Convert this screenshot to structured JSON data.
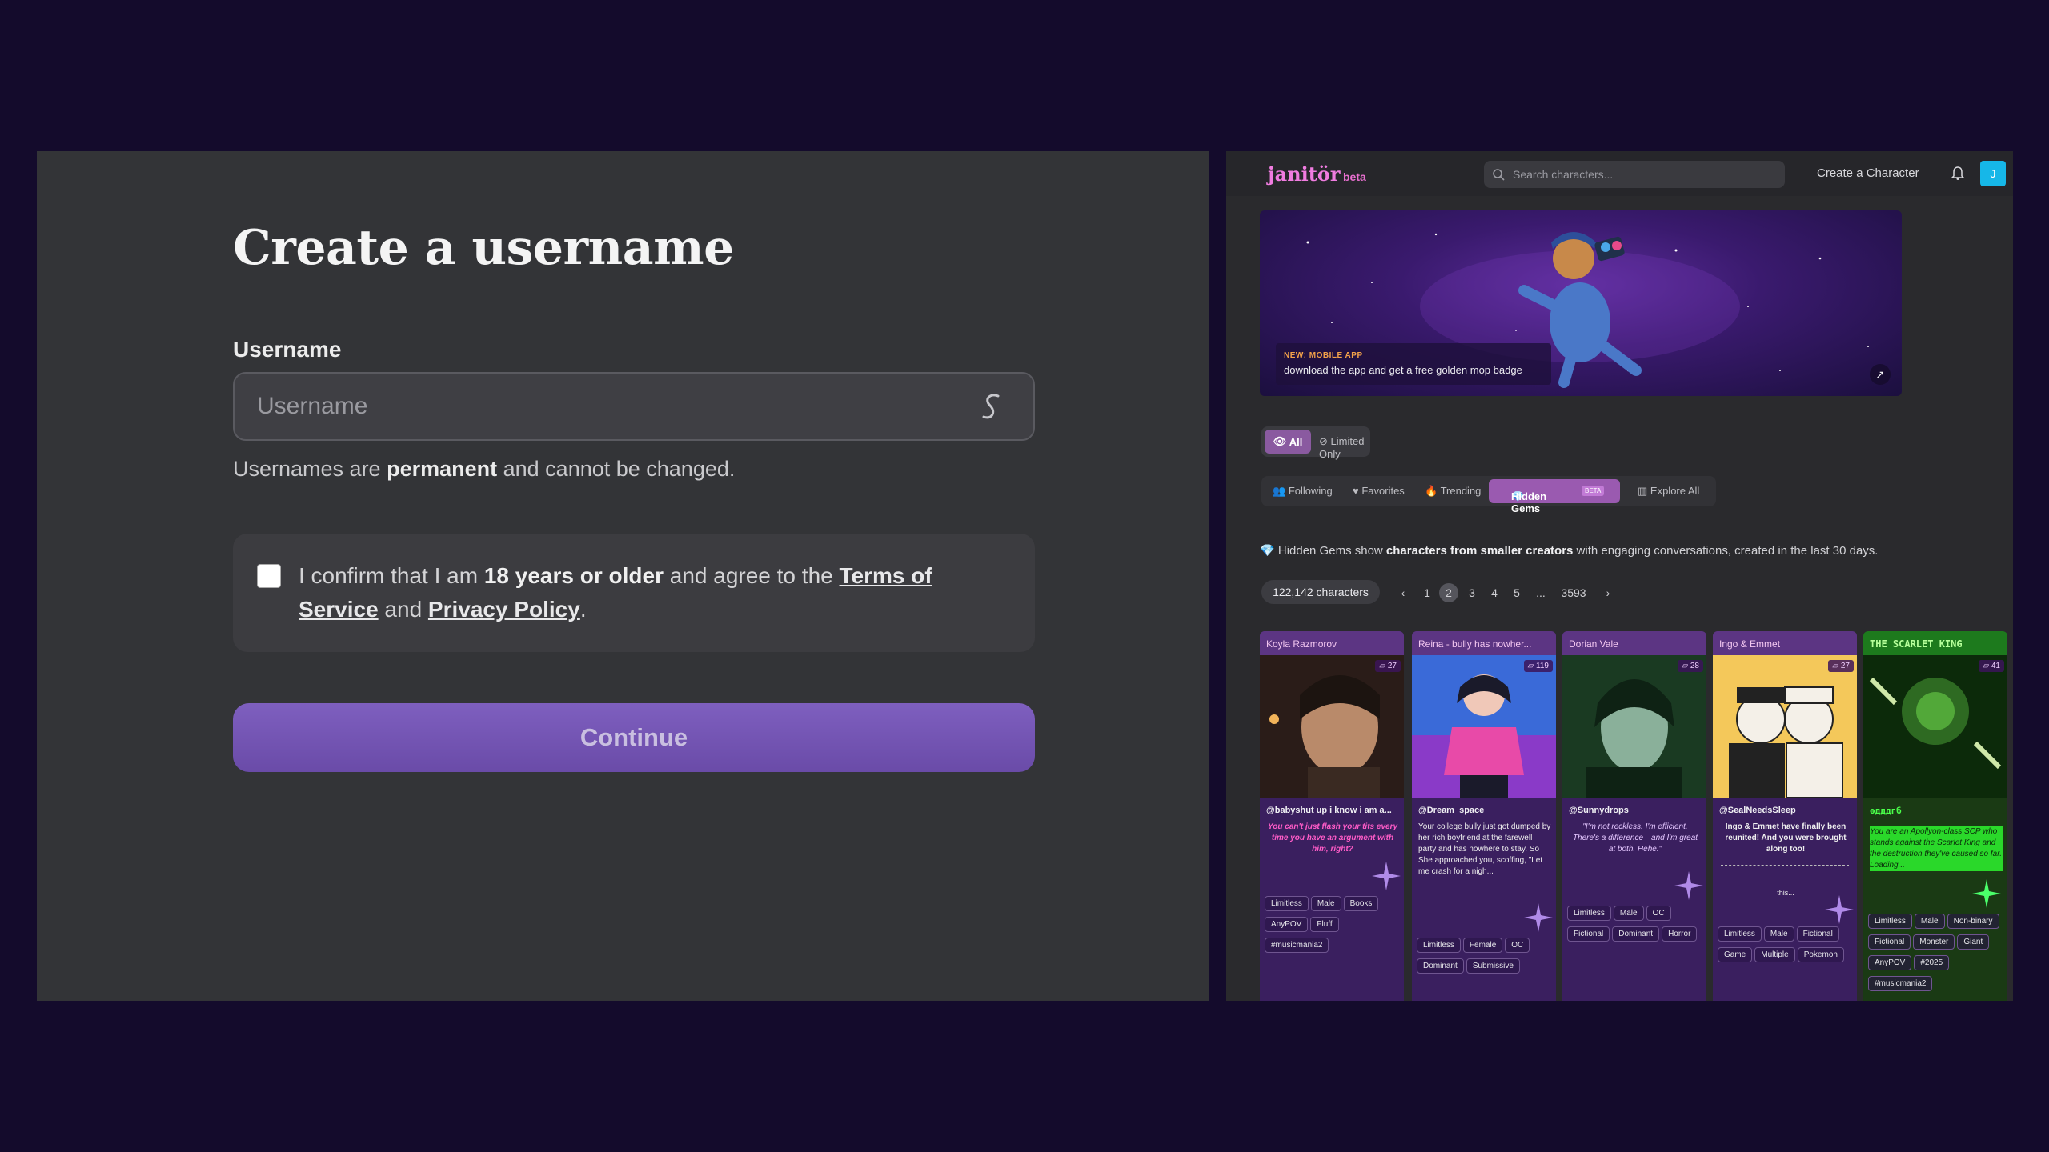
{
  "signup": {
    "title": "Create a username",
    "username_label": "Username",
    "username_placeholder": "Username",
    "hint_prefix": "Usernames are ",
    "hint_bold": "permanent",
    "hint_suffix": " and cannot be changed.",
    "confirm_prefix": "I confirm that I am ",
    "confirm_bold": "18 years or older",
    "confirm_mid": " and agree to the ",
    "terms_link": "Terms of Service",
    "confirm_and": " and ",
    "privacy_link": "Privacy Policy",
    "confirm_end": ".",
    "continue_label": "Continue"
  },
  "janitor": {
    "logo": "janitör",
    "logo_beta": "beta",
    "search_placeholder": "Search characters...",
    "create_link": "Create a Character",
    "avatar_letter": "J",
    "banner": {
      "tag": "NEW: MOBILE APP",
      "text": "download the app and get a free golden mop badge"
    },
    "toggle": {
      "all": "All",
      "limited": "Limited Only"
    },
    "filters": {
      "following": "Following",
      "favorites": "Favorites",
      "trending": "Trending",
      "hidden_gems": "Hidden Gems",
      "hidden_gems_badge": "BETA",
      "explore_all": "Explore All"
    },
    "gem_info_prefix": "Hidden Gems show ",
    "gem_info_bold": "characters from smaller creators",
    "gem_info_suffix": " with engaging conversations, created in the last 30 days.",
    "count_pill": "122,142 characters",
    "pages": [
      "1",
      "2",
      "3",
      "4",
      "5",
      "...",
      "3593"
    ],
    "active_page": "2",
    "cards": [
      {
        "name": "Koyla Razmorov",
        "count": "27",
        "author": "@babyshut up i know i am a...",
        "desc": "You can't just flash your tits every time you have an argument with him, right?",
        "tags": [
          "Limitless",
          "Male",
          "Books",
          "AnyPOV",
          "Fluff",
          "#musicmania2"
        ]
      },
      {
        "name": "Reina - bully has nowher...",
        "count": "119",
        "author": "@Dream_space",
        "desc": "Your college bully just got dumped by her rich boyfriend at the farewell party and has nowhere to stay. So She approached you, scoffing, \"Let me crash for a nigh...",
        "tags": [
          "Limitless",
          "Female",
          "OC",
          "Dominant",
          "Submissive"
        ]
      },
      {
        "name": "Dorian Vale",
        "count": "28",
        "author": "@Sunnydrops",
        "desc": "\"I'm not reckless. I'm efficient. There's a difference—and I'm great at both. Hehe.\"",
        "tags": [
          "Limitless",
          "Male",
          "OC",
          "Fictional",
          "Dominant",
          "Horror"
        ]
      },
      {
        "name": "Ingo & Emmet",
        "count": "27",
        "author": "@SealNeedsSleep",
        "desc": "Ingo & Emmet have finally been reunited! And you were brought along too!",
        "desc2": "this...",
        "tags": [
          "Limitless",
          "Male",
          "Fictional",
          "Game",
          "Multiple",
          "Pokemon"
        ]
      },
      {
        "name": "THE SCARLET KING",
        "count": "41",
        "author": "ѳдддгб",
        "desc": "You are an Apollyon-class SCP who stands against the Scarlet King and the destruction they've caused so far. Loading...",
        "tags": [
          "Limitless",
          "Male",
          "Non-binary",
          "Fictional",
          "Monster",
          "Giant",
          "AnyPOV",
          "#2025",
          "#musicmania2"
        ]
      }
    ],
    "colors": {
      "accent": "#9a5ab0",
      "brand": "#f07ce0"
    }
  }
}
